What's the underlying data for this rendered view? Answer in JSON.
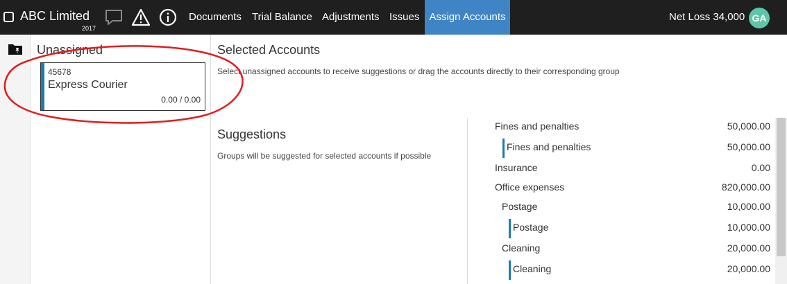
{
  "header": {
    "company": "ABC Limited",
    "year": "2017",
    "icons": [
      "chat-icon",
      "warning-icon",
      "info-icon"
    ],
    "nav": [
      {
        "label": "Documents",
        "active": false
      },
      {
        "label": "Trial Balance",
        "active": false
      },
      {
        "label": "Adjustments",
        "active": false
      },
      {
        "label": "Issues",
        "active": false
      },
      {
        "label": "Assign Accounts",
        "active": true
      }
    ],
    "net_loss": "Net Loss 34,000",
    "avatar_initials": "GA"
  },
  "rail": {
    "icon": "folder-pin-icon"
  },
  "unassigned": {
    "title": "Unassigned",
    "card": {
      "number": "45678",
      "name": "Express Courier",
      "balance": "0.00 / 0.00"
    }
  },
  "selected": {
    "title": "Selected Accounts",
    "hint": "Select unassigned accounts to receive suggestions or drag the accounts directly to their corresponding group"
  },
  "suggestions": {
    "title": "Suggestions",
    "hint": "Groups will be suggested for selected accounts if possible"
  },
  "groups": [
    {
      "name": "Fines and penalties",
      "value": "50,000.00",
      "level": 0
    },
    {
      "name": "Fines and penalties",
      "value": "50,000.00",
      "level": 1
    },
    {
      "name": "Insurance",
      "value": "0.00",
      "level": 0
    },
    {
      "name": "Office expenses",
      "value": "820,000.00",
      "level": 0
    },
    {
      "name": "Postage",
      "value": "10,000.00",
      "level": 2
    },
    {
      "name": "Postage",
      "value": "10,000.00",
      "level": 3
    },
    {
      "name": "Cleaning",
      "value": "20,000.00",
      "level": 2
    },
    {
      "name": "Cleaning",
      "value": "20,000.00",
      "level": 3
    }
  ],
  "colors": {
    "topbar": "#1f1f1f",
    "active_tab": "#3f84c4",
    "accent_bar": "#1b7bb1",
    "avatar": "#5cc6a6",
    "annotation": "#e11d1d"
  }
}
